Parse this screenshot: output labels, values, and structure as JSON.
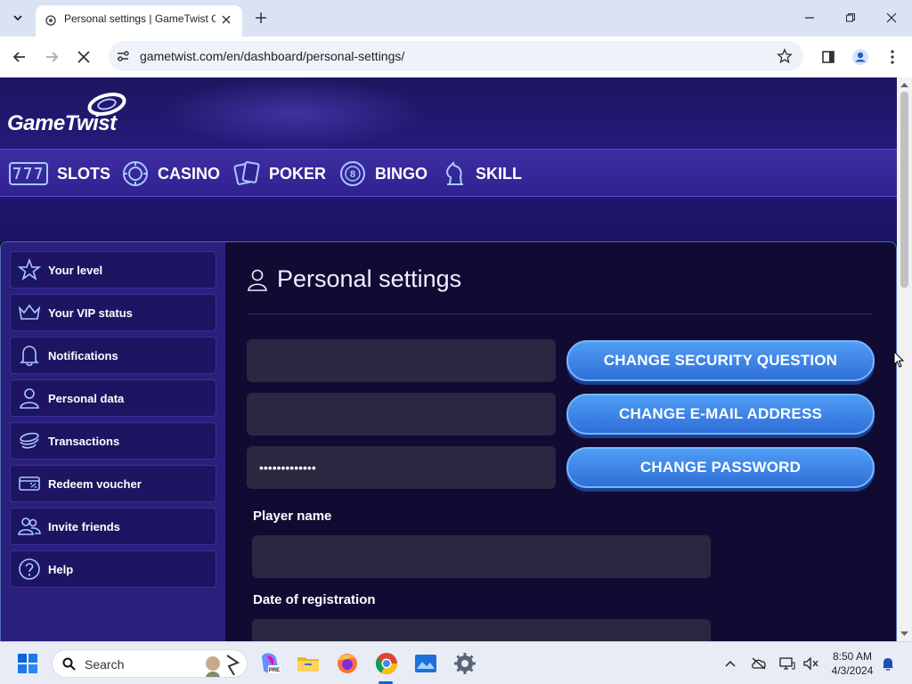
{
  "browser": {
    "tab_title": "Personal settings | GameTwist C",
    "url": "gametwist.com/en/dashboard/personal-settings/"
  },
  "brand": {
    "name_part1": "Game",
    "name_part2": "Twist"
  },
  "nav": [
    {
      "label": "SLOTS",
      "icon": "slots-icon"
    },
    {
      "label": "CASINO",
      "icon": "casino-chip-icon"
    },
    {
      "label": "POKER",
      "icon": "poker-cards-icon"
    },
    {
      "label": "BINGO",
      "icon": "bingo-ball-icon"
    },
    {
      "label": "SKILL",
      "icon": "chess-knight-icon"
    }
  ],
  "sidebar": [
    {
      "label": "Your level",
      "icon": "star-icon"
    },
    {
      "label": "Your VIP status",
      "icon": "crown-icon"
    },
    {
      "label": "Notifications",
      "icon": "bell-icon"
    },
    {
      "label": "Personal data",
      "icon": "person-icon"
    },
    {
      "label": "Transactions",
      "icon": "coins-icon"
    },
    {
      "label": "Redeem voucher",
      "icon": "voucher-icon"
    },
    {
      "label": "Invite friends",
      "icon": "friends-icon"
    },
    {
      "label": "Help",
      "icon": "help-icon"
    }
  ],
  "main": {
    "title": "Personal settings",
    "fields": [
      {
        "value": "",
        "button": "CHANGE SECURITY QUESTION"
      },
      {
        "value": "",
        "button": "CHANGE E-MAIL ADDRESS"
      },
      {
        "value": "•••••••••••••",
        "button": "CHANGE PASSWORD"
      }
    ],
    "player_name_label": "Player name",
    "date_registration_label": "Date of registration"
  },
  "taskbar": {
    "search_placeholder": "Search",
    "time": "8:50 AM",
    "date": "4/3/2024"
  },
  "colors": {
    "accent_blue": "#3d86e8",
    "page_bg": "#110b34",
    "sidebar_bg": "#2a1f7d"
  }
}
